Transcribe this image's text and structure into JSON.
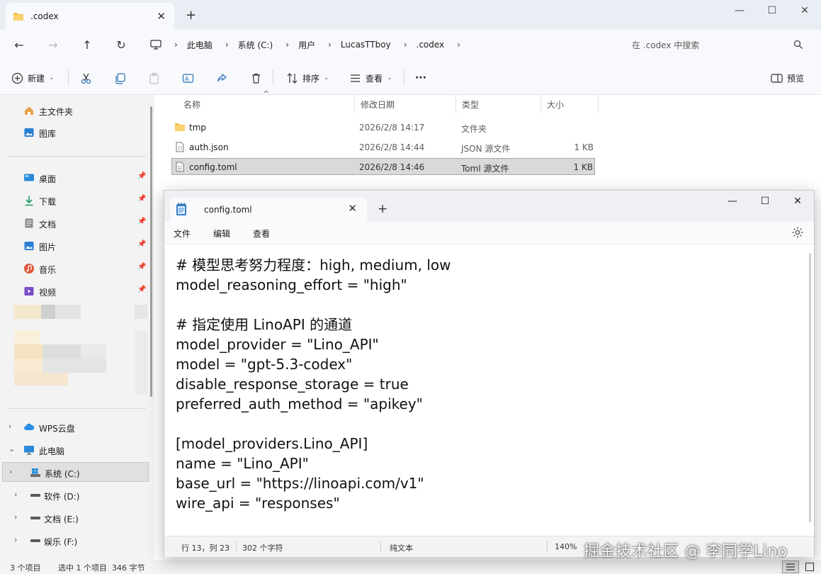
{
  "explorer": {
    "tab": {
      "title": ".codex"
    },
    "breadcrumbs": [
      "此电脑",
      "系统 (C:)",
      "用户",
      "LucasTTboy",
      ".codex"
    ],
    "search": {
      "placeholder": "在 .codex 中搜索"
    },
    "toolbar": {
      "new_label": "新建",
      "sort_label": "排序",
      "view_label": "查看",
      "more_label": "···",
      "preview_label": "预览"
    },
    "sidebar": {
      "quick": [
        {
          "label": "主文件夹",
          "icon": "home-icon"
        },
        {
          "label": "图库",
          "icon": "gallery-icon"
        }
      ],
      "pinned": [
        {
          "label": "桌面",
          "icon": "desktop-icon",
          "color": "#2b8ad8"
        },
        {
          "label": "下载",
          "icon": "download-icon",
          "color": "#1e9e63"
        },
        {
          "label": "文档",
          "icon": "document-icon",
          "color": "#7a7a7a"
        },
        {
          "label": "图片",
          "icon": "pictures-icon",
          "color": "#2a7fd4"
        },
        {
          "label": "音乐",
          "icon": "music-icon",
          "color": "#e0573a"
        },
        {
          "label": "视频",
          "icon": "video-icon",
          "color": "#7a4cc8"
        }
      ],
      "drives": {
        "wps_label": "WPS云盘",
        "this_pc_label": "此电脑",
        "items": [
          {
            "label": "系统 (C:)"
          },
          {
            "label": "软件 (D:)"
          },
          {
            "label": "文档 (E:)"
          },
          {
            "label": "娱乐 (F:)"
          }
        ]
      }
    },
    "columns": {
      "name": "名称",
      "date": "修改日期",
      "type": "类型",
      "size": "大小"
    },
    "files": [
      {
        "name": "tmp",
        "date": "2026/2/8 14:17",
        "type": "文件夹",
        "size": ""
      },
      {
        "name": "auth.json",
        "date": "2026/2/8 14:44",
        "type": "JSON 源文件",
        "size": "1 KB"
      },
      {
        "name": "config.toml",
        "date": "2026/2/8 14:46",
        "type": "Toml 源文件",
        "size": "1 KB"
      }
    ],
    "status": {
      "count": "3 个项目",
      "selection": "选中 1 个项目  346 字节"
    }
  },
  "notepad": {
    "tab_title": "config.toml",
    "menu": {
      "file": "文件",
      "edit": "编辑",
      "view": "查看"
    },
    "lines": [
      "# 模型思考努力程度：high, medium, low",
      "model_reasoning_effort = \"high\"",
      "",
      "# 指定使用 LinoAPI 的通道",
      "model_provider = \"Lino_API\"",
      "model = \"gpt-5.3-codex\"",
      "disable_response_storage = true",
      "preferred_auth_method = \"apikey\"",
      "",
      "[model_providers.Lino_API]",
      "name = \"Lino_API\"",
      "base_url = \"https://linoapi.com/v1\"",
      "wire_api = \"responses\""
    ],
    "status": {
      "position": "行 13，列 23",
      "chars": "302 个字符",
      "format": "纯文本",
      "zoom": "140%"
    }
  },
  "watermark": "掘金技术社区 @ 李同学Lino",
  "colors": {
    "folder": "#f4c04a",
    "accent": "#0067c0",
    "selection": "#d9d9d9"
  }
}
